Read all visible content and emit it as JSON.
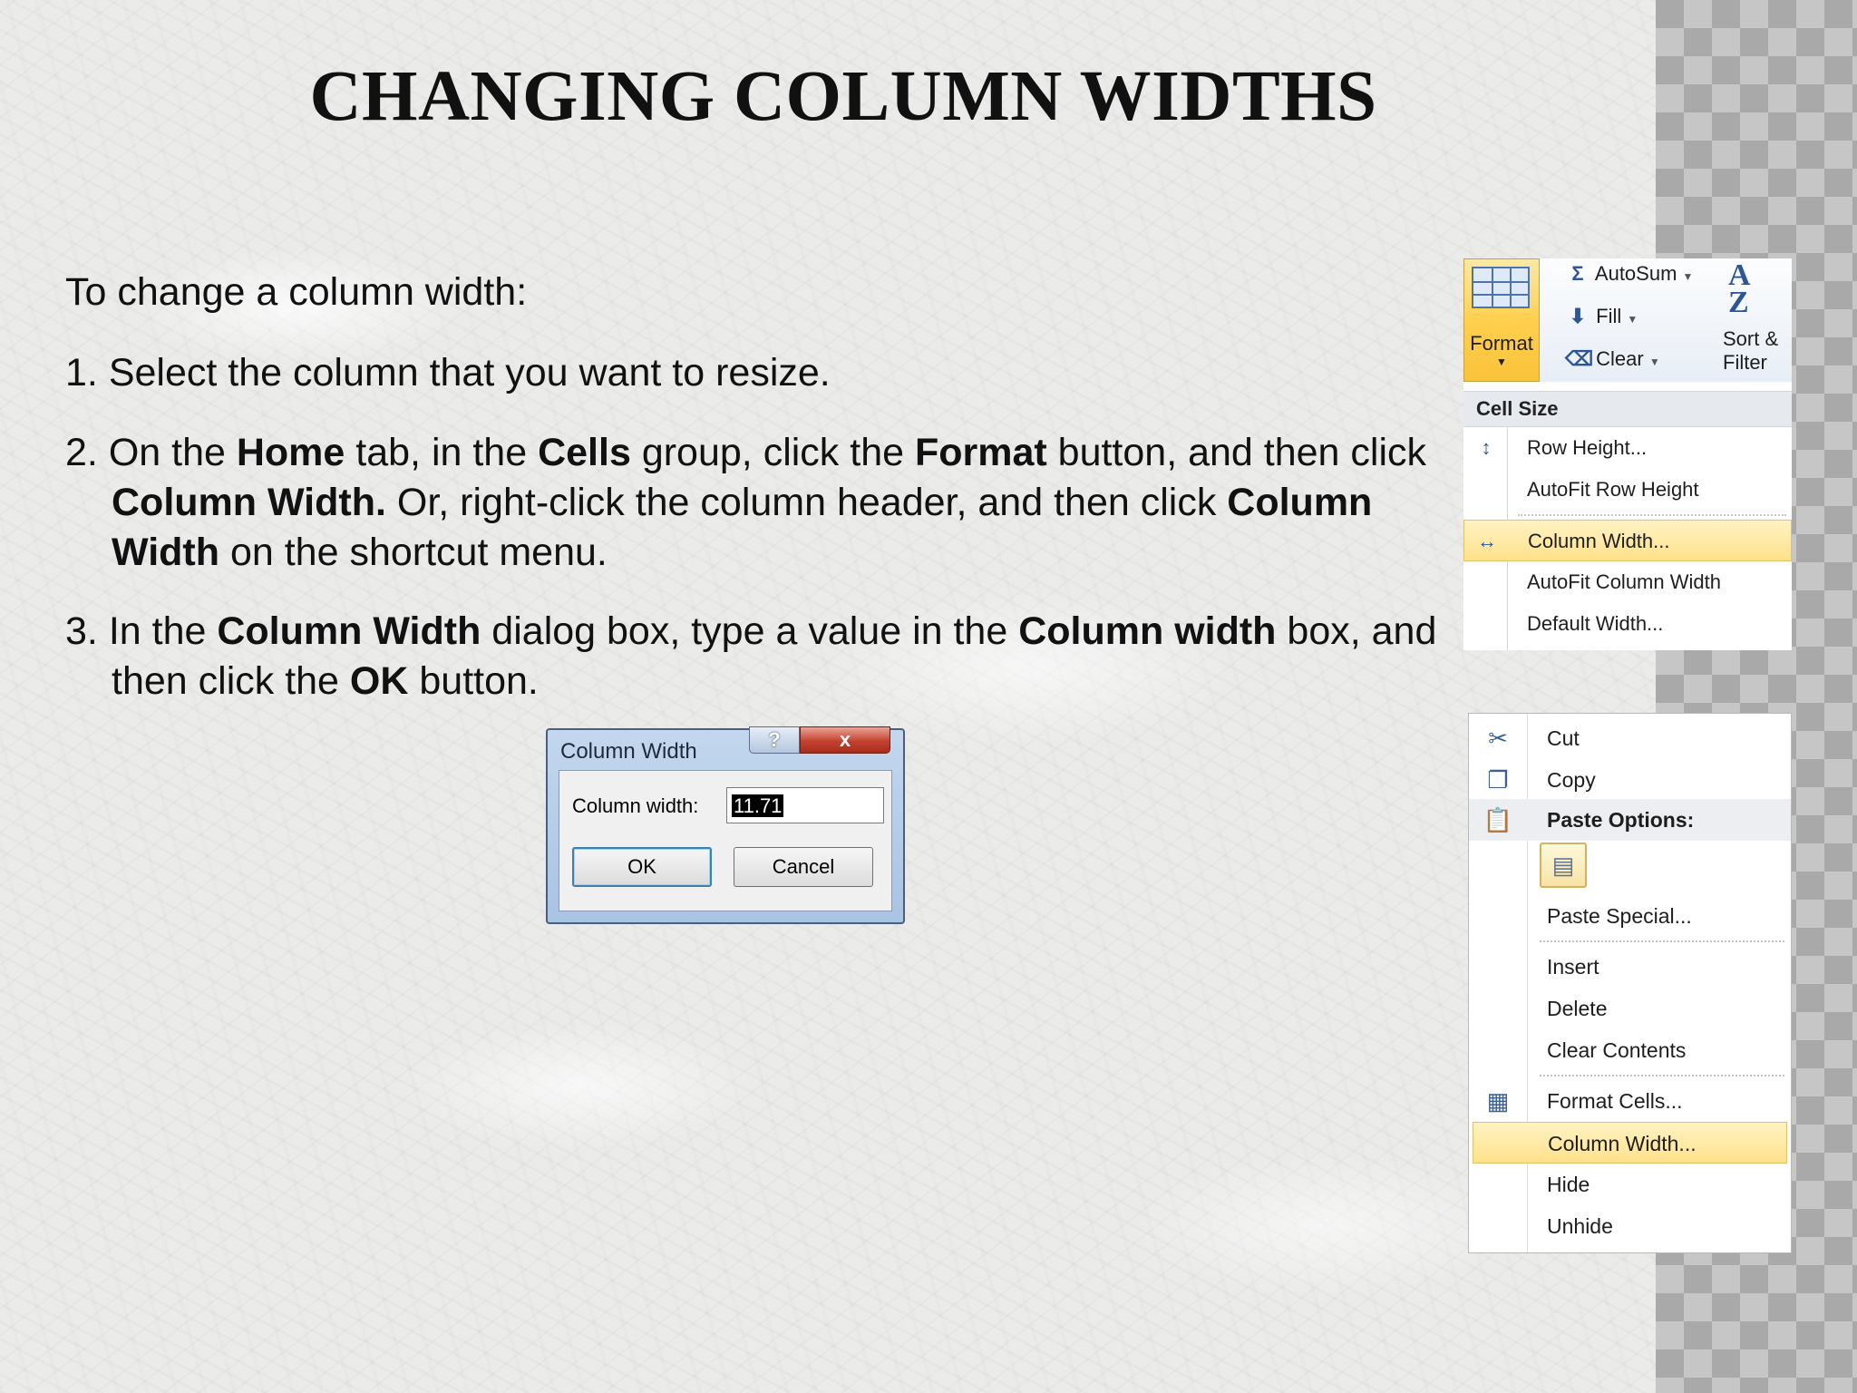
{
  "slide": {
    "title": "CHANGING COLUMN WIDTHS",
    "intro": "To change a column width:",
    "steps": [
      {
        "num": "1.",
        "parts": [
          "Select the column that you want to resize."
        ]
      },
      {
        "num": "2.",
        "parts": [
          "On the ",
          "Home",
          " tab, in the ",
          "Cells",
          " group, click the ",
          "Format",
          " button, and then click ",
          "Column Width.",
          " Or, right-click the column header, and then click ",
          "Column Width",
          " on the shortcut menu."
        ]
      },
      {
        "num": "3.",
        "parts": [
          "In the ",
          "Column Width",
          " dialog box, type a value in the ",
          "Column width",
          " box, and then click the ",
          "OK",
          " button."
        ]
      }
    ]
  },
  "dialog": {
    "title": "Column Width",
    "help": "?",
    "close": "x",
    "field_label": "Column width:",
    "field_value": "11.71",
    "ok": "OK",
    "cancel": "Cancel"
  },
  "ribbon": {
    "format_label": "Format",
    "autosum": "AutoSum",
    "fill": "Fill",
    "clear": "Clear",
    "sort_line1": "Sort &",
    "sort_line2": "Filter",
    "cell_size_header": "Cell Size",
    "items": [
      "Row Height...",
      "AutoFit Row Height",
      "Column Width...",
      "AutoFit Column Width",
      "Default Width..."
    ]
  },
  "context_menu": {
    "items": [
      "Cut",
      "Copy",
      "Paste Options:",
      "Paste Special...",
      "Insert",
      "Delete",
      "Clear Contents",
      "Format Cells...",
      "Column Width...",
      "Hide",
      "Unhide"
    ]
  },
  "colors": {
    "highlight": "#ffe18a",
    "accent_blue": "#2b579a",
    "title_text": "#111111"
  }
}
